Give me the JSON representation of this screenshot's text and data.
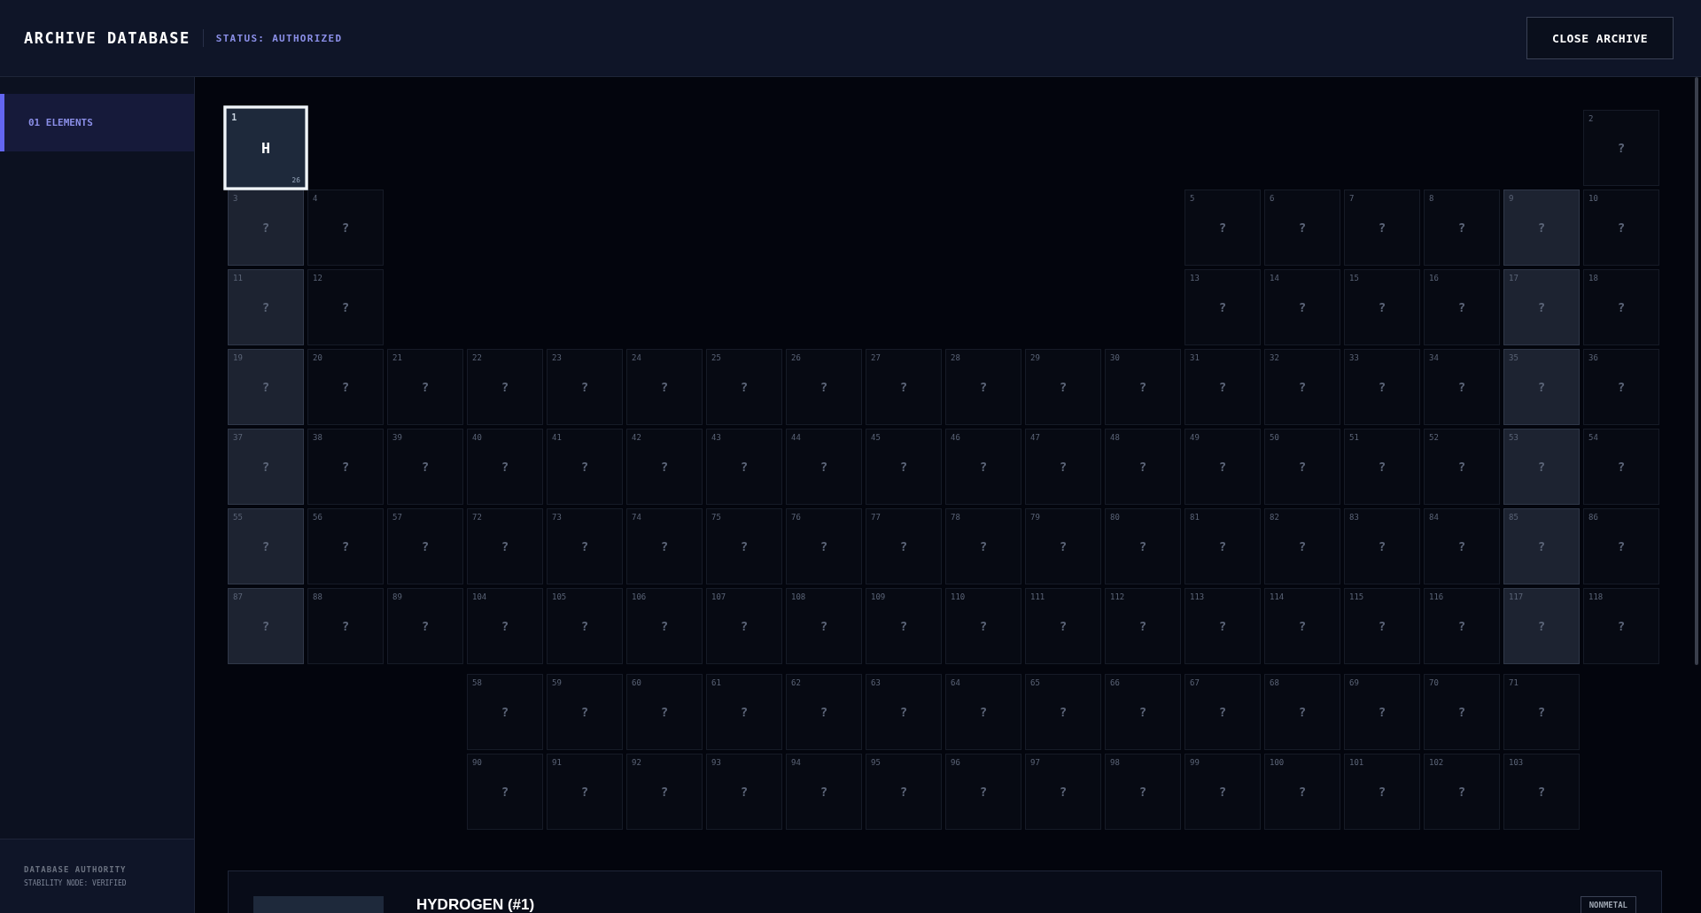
{
  "header": {
    "title": "ARCHIVE DATABASE",
    "status": "STATUS: AUTHORIZED",
    "close_button": "CLOSE ARCHIVE"
  },
  "sidebar": {
    "items": [
      {
        "label": "01 ELEMENTS",
        "selected": true
      }
    ],
    "footer": {
      "title": "DATABASE AUTHORITY",
      "subtitle": "STABILITY NODE: VERIFIED"
    }
  },
  "periodic_table": {
    "periods": [
      {
        "kind": "period",
        "cells": [
          {
            "number": "1",
            "symbol": "H",
            "corner": "26",
            "locked": false,
            "selected": true,
            "shaded": false
          },
          {
            "number": "2",
            "symbol": "?",
            "locked": true,
            "selected": false,
            "shaded": false
          }
        ]
      },
      {
        "kind": "period",
        "cells": [
          {
            "number": "3",
            "symbol": "?",
            "locked": true,
            "selected": false,
            "shaded": true
          },
          {
            "number": "4",
            "symbol": "?",
            "locked": true,
            "selected": false,
            "shaded": false
          },
          {
            "number": "5",
            "symbol": "?",
            "locked": true,
            "selected": false,
            "shaded": false
          },
          {
            "number": "6",
            "symbol": "?",
            "locked": true,
            "selected": false,
            "shaded": false
          },
          {
            "number": "7",
            "symbol": "?",
            "locked": true,
            "selected": false,
            "shaded": false
          },
          {
            "number": "8",
            "symbol": "?",
            "locked": true,
            "selected": false,
            "shaded": false
          },
          {
            "number": "9",
            "symbol": "?",
            "locked": true,
            "selected": false,
            "shaded": true
          },
          {
            "number": "10",
            "symbol": "?",
            "locked": true,
            "selected": false,
            "shaded": false
          }
        ]
      },
      {
        "kind": "period",
        "cells": [
          {
            "number": "11",
            "symbol": "?",
            "locked": true,
            "selected": false,
            "shaded": true
          },
          {
            "number": "12",
            "symbol": "?",
            "locked": true,
            "selected": false,
            "shaded": false
          },
          {
            "number": "13",
            "symbol": "?",
            "locked": true,
            "selected": false,
            "shaded": false
          },
          {
            "number": "14",
            "symbol": "?",
            "locked": true,
            "selected": false,
            "shaded": false
          },
          {
            "number": "15",
            "symbol": "?",
            "locked": true,
            "selected": false,
            "shaded": false
          },
          {
            "number": "16",
            "symbol": "?",
            "locked": true,
            "selected": false,
            "shaded": false
          },
          {
            "number": "17",
            "symbol": "?",
            "locked": true,
            "selected": false,
            "shaded": true
          },
          {
            "number": "18",
            "symbol": "?",
            "locked": true,
            "selected": false,
            "shaded": false
          }
        ]
      },
      {
        "kind": "period",
        "cells": [
          {
            "number": "19",
            "symbol": "?",
            "locked": true,
            "selected": false,
            "shaded": true
          },
          {
            "number": "20",
            "symbol": "?",
            "locked": true,
            "selected": false,
            "shaded": false
          },
          {
            "number": "21",
            "symbol": "?",
            "locked": true,
            "selected": false,
            "shaded": false
          },
          {
            "number": "22",
            "symbol": "?",
            "locked": true,
            "selected": false,
            "shaded": false
          },
          {
            "number": "23",
            "symbol": "?",
            "locked": true,
            "selected": false,
            "shaded": false
          },
          {
            "number": "24",
            "symbol": "?",
            "locked": true,
            "selected": false,
            "shaded": false
          },
          {
            "number": "25",
            "symbol": "?",
            "locked": true,
            "selected": false,
            "shaded": false
          },
          {
            "number": "26",
            "symbol": "?",
            "locked": true,
            "selected": false,
            "shaded": false
          },
          {
            "number": "27",
            "symbol": "?",
            "locked": true,
            "selected": false,
            "shaded": false
          },
          {
            "number": "28",
            "symbol": "?",
            "locked": true,
            "selected": false,
            "shaded": false
          },
          {
            "number": "29",
            "symbol": "?",
            "locked": true,
            "selected": false,
            "shaded": false
          },
          {
            "number": "30",
            "symbol": "?",
            "locked": true,
            "selected": false,
            "shaded": false
          },
          {
            "number": "31",
            "symbol": "?",
            "locked": true,
            "selected": false,
            "shaded": false
          },
          {
            "number": "32",
            "symbol": "?",
            "locked": true,
            "selected": false,
            "shaded": false
          },
          {
            "number": "33",
            "symbol": "?",
            "locked": true,
            "selected": false,
            "shaded": false
          },
          {
            "number": "34",
            "symbol": "?",
            "locked": true,
            "selected": false,
            "shaded": false
          },
          {
            "number": "35",
            "symbol": "?",
            "locked": true,
            "selected": false,
            "shaded": true
          },
          {
            "number": "36",
            "symbol": "?",
            "locked": true,
            "selected": false,
            "shaded": false
          }
        ]
      },
      {
        "kind": "period",
        "cells": [
          {
            "number": "37",
            "symbol": "?",
            "locked": true,
            "selected": false,
            "shaded": true
          },
          {
            "number": "38",
            "symbol": "?",
            "locked": true,
            "selected": false,
            "shaded": false
          },
          {
            "number": "39",
            "symbol": "?",
            "locked": true,
            "selected": false,
            "shaded": false
          },
          {
            "number": "40",
            "symbol": "?",
            "locked": true,
            "selected": false,
            "shaded": false
          },
          {
            "number": "41",
            "symbol": "?",
            "locked": true,
            "selected": false,
            "shaded": false
          },
          {
            "number": "42",
            "symbol": "?",
            "locked": true,
            "selected": false,
            "shaded": false
          },
          {
            "number": "43",
            "symbol": "?",
            "locked": true,
            "selected": false,
            "shaded": false
          },
          {
            "number": "44",
            "symbol": "?",
            "locked": true,
            "selected": false,
            "shaded": false
          },
          {
            "number": "45",
            "symbol": "?",
            "locked": true,
            "selected": false,
            "shaded": false
          },
          {
            "number": "46",
            "symbol": "?",
            "locked": true,
            "selected": false,
            "shaded": false
          },
          {
            "number": "47",
            "symbol": "?",
            "locked": true,
            "selected": false,
            "shaded": false
          },
          {
            "number": "48",
            "symbol": "?",
            "locked": true,
            "selected": false,
            "shaded": false
          },
          {
            "number": "49",
            "symbol": "?",
            "locked": true,
            "selected": false,
            "shaded": false
          },
          {
            "number": "50",
            "symbol": "?",
            "locked": true,
            "selected": false,
            "shaded": false
          },
          {
            "number": "51",
            "symbol": "?",
            "locked": true,
            "selected": false,
            "shaded": false
          },
          {
            "number": "52",
            "symbol": "?",
            "locked": true,
            "selected": false,
            "shaded": false
          },
          {
            "number": "53",
            "symbol": "?",
            "locked": true,
            "selected": false,
            "shaded": true
          },
          {
            "number": "54",
            "symbol": "?",
            "locked": true,
            "selected": false,
            "shaded": false
          }
        ]
      },
      {
        "kind": "period",
        "cells": [
          {
            "number": "55",
            "symbol": "?",
            "locked": true,
            "selected": false,
            "shaded": true
          },
          {
            "number": "56",
            "symbol": "?",
            "locked": true,
            "selected": false,
            "shaded": false
          },
          {
            "number": "57",
            "symbol": "?",
            "locked": true,
            "selected": false,
            "shaded": false
          },
          {
            "number": "72",
            "symbol": "?",
            "locked": true,
            "selected": false,
            "shaded": false
          },
          {
            "number": "73",
            "symbol": "?",
            "locked": true,
            "selected": false,
            "shaded": false
          },
          {
            "number": "74",
            "symbol": "?",
            "locked": true,
            "selected": false,
            "shaded": false
          },
          {
            "number": "75",
            "symbol": "?",
            "locked": true,
            "selected": false,
            "shaded": false
          },
          {
            "number": "76",
            "symbol": "?",
            "locked": true,
            "selected": false,
            "shaded": false
          },
          {
            "number": "77",
            "symbol": "?",
            "locked": true,
            "selected": false,
            "shaded": false
          },
          {
            "number": "78",
            "symbol": "?",
            "locked": true,
            "selected": false,
            "shaded": false
          },
          {
            "number": "79",
            "symbol": "?",
            "locked": true,
            "selected": false,
            "shaded": false
          },
          {
            "number": "80",
            "symbol": "?",
            "locked": true,
            "selected": false,
            "shaded": false
          },
          {
            "number": "81",
            "symbol": "?",
            "locked": true,
            "selected": false,
            "shaded": false
          },
          {
            "number": "82",
            "symbol": "?",
            "locked": true,
            "selected": false,
            "shaded": false
          },
          {
            "number": "83",
            "symbol": "?",
            "locked": true,
            "selected": false,
            "shaded": false
          },
          {
            "number": "84",
            "symbol": "?",
            "locked": true,
            "selected": false,
            "shaded": false
          },
          {
            "number": "85",
            "symbol": "?",
            "locked": true,
            "selected": false,
            "shaded": true
          },
          {
            "number": "86",
            "symbol": "?",
            "locked": true,
            "selected": false,
            "shaded": false
          }
        ]
      },
      {
        "kind": "period",
        "cells": [
          {
            "number": "87",
            "symbol": "?",
            "locked": true,
            "selected": false,
            "shaded": true
          },
          {
            "number": "88",
            "symbol": "?",
            "locked": true,
            "selected": false,
            "shaded": false
          },
          {
            "number": "89",
            "symbol": "?",
            "locked": true,
            "selected": false,
            "shaded": false
          },
          {
            "number": "104",
            "symbol": "?",
            "locked": true,
            "selected": false,
            "shaded": false
          },
          {
            "number": "105",
            "symbol": "?",
            "locked": true,
            "selected": false,
            "shaded": false
          },
          {
            "number": "106",
            "symbol": "?",
            "locked": true,
            "selected": false,
            "shaded": false
          },
          {
            "number": "107",
            "symbol": "?",
            "locked": true,
            "selected": false,
            "shaded": false
          },
          {
            "number": "108",
            "symbol": "?",
            "locked": true,
            "selected": false,
            "shaded": false
          },
          {
            "number": "109",
            "symbol": "?",
            "locked": true,
            "selected": false,
            "shaded": false
          },
          {
            "number": "110",
            "symbol": "?",
            "locked": true,
            "selected": false,
            "shaded": false
          },
          {
            "number": "111",
            "symbol": "?",
            "locked": true,
            "selected": false,
            "shaded": false
          },
          {
            "number": "112",
            "symbol": "?",
            "locked": true,
            "selected": false,
            "shaded": false
          },
          {
            "number": "113",
            "symbol": "?",
            "locked": true,
            "selected": false,
            "shaded": false
          },
          {
            "number": "114",
            "symbol": "?",
            "locked": true,
            "selected": false,
            "shaded": false
          },
          {
            "number": "115",
            "symbol": "?",
            "locked": true,
            "selected": false,
            "shaded": false
          },
          {
            "number": "116",
            "symbol": "?",
            "locked": true,
            "selected": false,
            "shaded": false
          },
          {
            "number": "117",
            "symbol": "?",
            "locked": true,
            "selected": false,
            "shaded": true
          },
          {
            "number": "118",
            "symbol": "?",
            "locked": true,
            "selected": false,
            "shaded": false
          }
        ]
      },
      {
        "kind": "series",
        "cells": [
          {
            "number": "58",
            "symbol": "?",
            "locked": true,
            "selected": false,
            "shaded": false
          },
          {
            "number": "59",
            "symbol": "?",
            "locked": true,
            "selected": false,
            "shaded": false
          },
          {
            "number": "60",
            "symbol": "?",
            "locked": true,
            "selected": false,
            "shaded": false
          },
          {
            "number": "61",
            "symbol": "?",
            "locked": true,
            "selected": false,
            "shaded": false
          },
          {
            "number": "62",
            "symbol": "?",
            "locked": true,
            "selected": false,
            "shaded": false
          },
          {
            "number": "63",
            "symbol": "?",
            "locked": true,
            "selected": false,
            "shaded": false
          },
          {
            "number": "64",
            "symbol": "?",
            "locked": true,
            "selected": false,
            "shaded": false
          },
          {
            "number": "65",
            "symbol": "?",
            "locked": true,
            "selected": false,
            "shaded": false
          },
          {
            "number": "66",
            "symbol": "?",
            "locked": true,
            "selected": false,
            "shaded": false
          },
          {
            "number": "67",
            "symbol": "?",
            "locked": true,
            "selected": false,
            "shaded": false
          },
          {
            "number": "68",
            "symbol": "?",
            "locked": true,
            "selected": false,
            "shaded": false
          },
          {
            "number": "69",
            "symbol": "?",
            "locked": true,
            "selected": false,
            "shaded": false
          },
          {
            "number": "70",
            "symbol": "?",
            "locked": true,
            "selected": false,
            "shaded": false
          },
          {
            "number": "71",
            "symbol": "?",
            "locked": true,
            "selected": false,
            "shaded": false
          }
        ]
      },
      {
        "kind": "series",
        "cells": [
          {
            "number": "90",
            "symbol": "?",
            "locked": true,
            "selected": false,
            "shaded": false
          },
          {
            "number": "91",
            "symbol": "?",
            "locked": true,
            "selected": false,
            "shaded": false
          },
          {
            "number": "92",
            "symbol": "?",
            "locked": true,
            "selected": false,
            "shaded": false
          },
          {
            "number": "93",
            "symbol": "?",
            "locked": true,
            "selected": false,
            "shaded": false
          },
          {
            "number": "94",
            "symbol": "?",
            "locked": true,
            "selected": false,
            "shaded": false
          },
          {
            "number": "95",
            "symbol": "?",
            "locked": true,
            "selected": false,
            "shaded": false
          },
          {
            "number": "96",
            "symbol": "?",
            "locked": true,
            "selected": false,
            "shaded": false
          },
          {
            "number": "97",
            "symbol": "?",
            "locked": true,
            "selected": false,
            "shaded": false
          },
          {
            "number": "98",
            "symbol": "?",
            "locked": true,
            "selected": false,
            "shaded": false
          },
          {
            "number": "99",
            "symbol": "?",
            "locked": true,
            "selected": false,
            "shaded": false
          },
          {
            "number": "100",
            "symbol": "?",
            "locked": true,
            "selected": false,
            "shaded": false
          },
          {
            "number": "101",
            "symbol": "?",
            "locked": true,
            "selected": false,
            "shaded": false
          },
          {
            "number": "102",
            "symbol": "?",
            "locked": true,
            "selected": false,
            "shaded": false
          },
          {
            "number": "103",
            "symbol": "?",
            "locked": true,
            "selected": false,
            "shaded": false
          }
        ]
      }
    ]
  },
  "detail": {
    "title": "HYDROGEN (#1)",
    "badge": "NONMETAL"
  }
}
